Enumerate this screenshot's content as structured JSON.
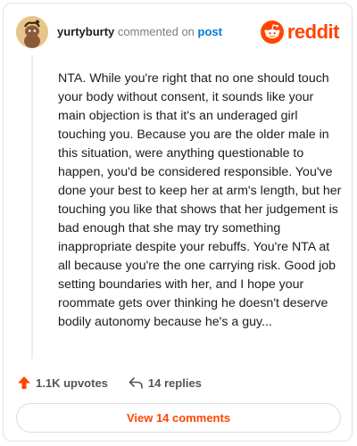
{
  "header": {
    "username": "yurtyburty",
    "commented_on": "commented on",
    "post_link": "post",
    "brand": "reddit"
  },
  "comment": {
    "text": "NTA. While you're right that no one should touch your body without consent, it sounds like your main objection is that it's an underaged girl touching you. Because you are the older male in this situation, were anything questionable to happen, you'd be considered responsible. You've done your best to keep her at arm's length, but her touching you like that shows that her judgement is bad enough that she may try something inappropriate despite your rebuffs. You're NTA at all because you're the one carrying risk. Good job setting boundaries with her, and I hope your roommate gets over thinking he doesn't deserve bodily autonomy because he's a guy..."
  },
  "actions": {
    "upvotes": "1.1K upvotes",
    "replies": "14 replies"
  },
  "footer": {
    "view_comments": "View 14 comments"
  },
  "colors": {
    "brand": "#ff4500",
    "link": "#0079d3"
  },
  "icons": {
    "avatar": "snoo-avatar",
    "logo": "reddit-alien-icon",
    "upvote": "upvote-arrow-icon",
    "reply": "reply-arrow-icon"
  }
}
